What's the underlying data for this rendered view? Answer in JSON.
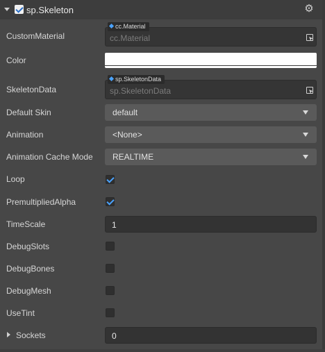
{
  "header": {
    "title": "sp.Skeleton",
    "enabled": true,
    "icons": {
      "collapse": "caret-down-icon",
      "settings": "gear-icon"
    }
  },
  "fields": {
    "custom_material": {
      "label": "CustomMaterial",
      "asset_type": "cc.Material",
      "placeholder": "cc.Material"
    },
    "color": {
      "label": "Color",
      "value": "#ffffff"
    },
    "skeleton_data": {
      "label": "SkeletonData",
      "asset_type": "sp.SkeletonData",
      "placeholder": "sp.SkeletonData"
    },
    "default_skin": {
      "label": "Default Skin",
      "value": "default"
    },
    "animation": {
      "label": "Animation",
      "value": "<None>"
    },
    "animation_cache_mode": {
      "label": "Animation Cache Mode",
      "value": "REALTIME"
    },
    "loop": {
      "label": "Loop",
      "checked": true
    },
    "premultiplied_alpha": {
      "label": "PremultipliedAlpha",
      "checked": true
    },
    "time_scale": {
      "label": "TimeScale",
      "value": "1"
    },
    "debug_slots": {
      "label": "DebugSlots",
      "checked": false
    },
    "debug_bones": {
      "label": "DebugBones",
      "checked": false
    },
    "debug_mesh": {
      "label": "DebugMesh",
      "checked": false
    },
    "use_tint": {
      "label": "UseTint",
      "checked": false
    },
    "sockets": {
      "label": "Sockets",
      "value": "0"
    }
  },
  "colors": {
    "panel_bg": "#474747",
    "header_bg": "#3d3d3d",
    "accent": "#4aa3ff",
    "select_bg": "#5a5a5a",
    "field_bg": "#333333"
  }
}
